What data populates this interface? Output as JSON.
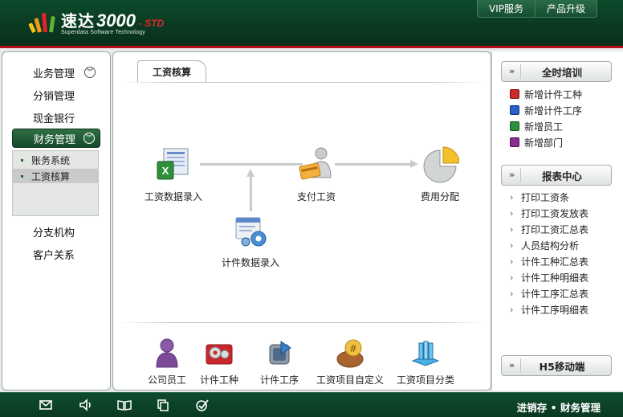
{
  "header": {
    "logo_cn": "速达",
    "logo_num": "3000",
    "logo_std": "- STD",
    "logo_sub": "Superdata Software Technology",
    "buttons": [
      "VIP服务",
      "产品升级"
    ]
  },
  "left_nav": {
    "items": [
      "业务管理",
      "分销管理",
      "现金银行",
      "财务管理",
      "分支机构",
      "客户关系"
    ],
    "active": "财务管理",
    "sub_items": [
      "账务系统",
      "工资核算"
    ],
    "sub_selected": "工资核算"
  },
  "main": {
    "tab": "工资核算",
    "flow": {
      "data_entry": "工资数据录入",
      "pay": "支付工资",
      "cost": "费用分配",
      "piece_entry": "计件数据录入"
    },
    "bottom": [
      "公司员工",
      "计件工种",
      "计件工序",
      "工资项目自定义",
      "工资项目分类"
    ]
  },
  "right": {
    "training": {
      "title": "全时培训",
      "items": [
        "新增计件工种",
        "新增计件工序",
        "新增员工",
        "新增部门"
      ]
    },
    "reports": {
      "title": "报表中心",
      "items": [
        "打印工资条",
        "打印工资发放表",
        "打印工资汇总表",
        "人员结构分析",
        "计件工种汇总表",
        "计件工种明细表",
        "计件工序汇总表",
        "计件工序明细表"
      ]
    },
    "h5": {
      "title": "H5移动端"
    }
  },
  "footer": {
    "text": "进销存 • 财务管理",
    "icons": [
      "mail-icon",
      "speaker-icon",
      "book-icon",
      "copy-icon",
      "check-icon"
    ]
  },
  "colors": {
    "brand_green": "#0e4a2c",
    "accent_red": "#b3121c"
  }
}
